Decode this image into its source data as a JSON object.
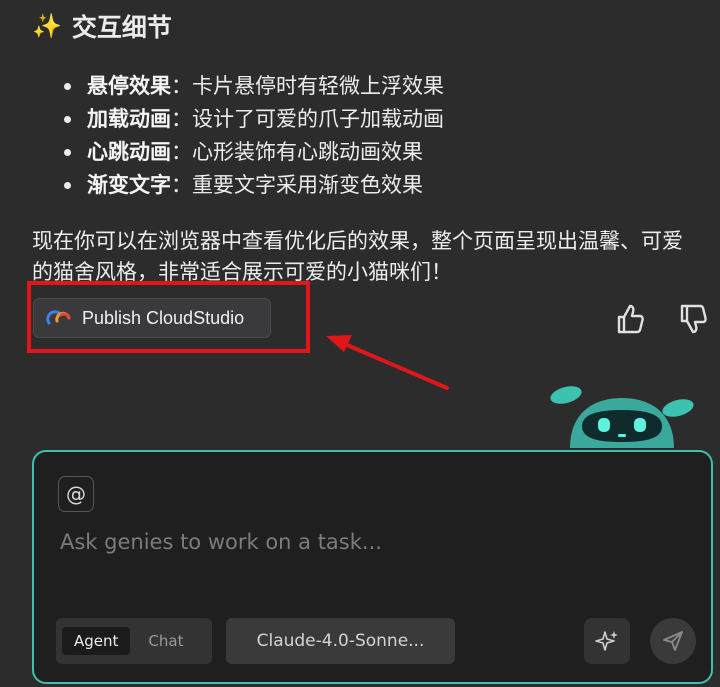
{
  "heading": {
    "icon": "sparkles-icon",
    "title": "交互细节"
  },
  "features": [
    {
      "label": "悬停效果",
      "sep": "：",
      "text": "卡片悬停时有轻微上浮效果"
    },
    {
      "label": "加载动画",
      "sep": "：",
      "text": "设计了可爱的爪子加载动画"
    },
    {
      "label": "心跳动画",
      "sep": "：",
      "text": "心形装饰有心跳动画效果"
    },
    {
      "label": "渐变文字",
      "sep": "：",
      "text": "重要文字采用渐变色效果"
    }
  ],
  "summary": "现在你可以在浏览器中查看优化后的效果，整个页面呈现出温馨、可爱的猫舍风格，非常适合展示可爱的小猫咪们！",
  "publish": {
    "icon": "cloudstudio-logo-icon",
    "label": "Publish CloudStudio"
  },
  "feedback": {
    "like_icon": "thumbs-up-icon",
    "dislike_icon": "thumbs-down-icon"
  },
  "composer": {
    "at_label": "@",
    "placeholder": "Ask genies to work on a task...",
    "modes": [
      "Agent",
      "Chat"
    ],
    "active_mode": "Agent",
    "model": "Claude-4.0-Sonne...",
    "ai_icon": "sparkle-ai-icon",
    "send_icon": "send-icon",
    "accent": "#3fbfae"
  },
  "annotation": {
    "box_color": "#e0161a"
  }
}
